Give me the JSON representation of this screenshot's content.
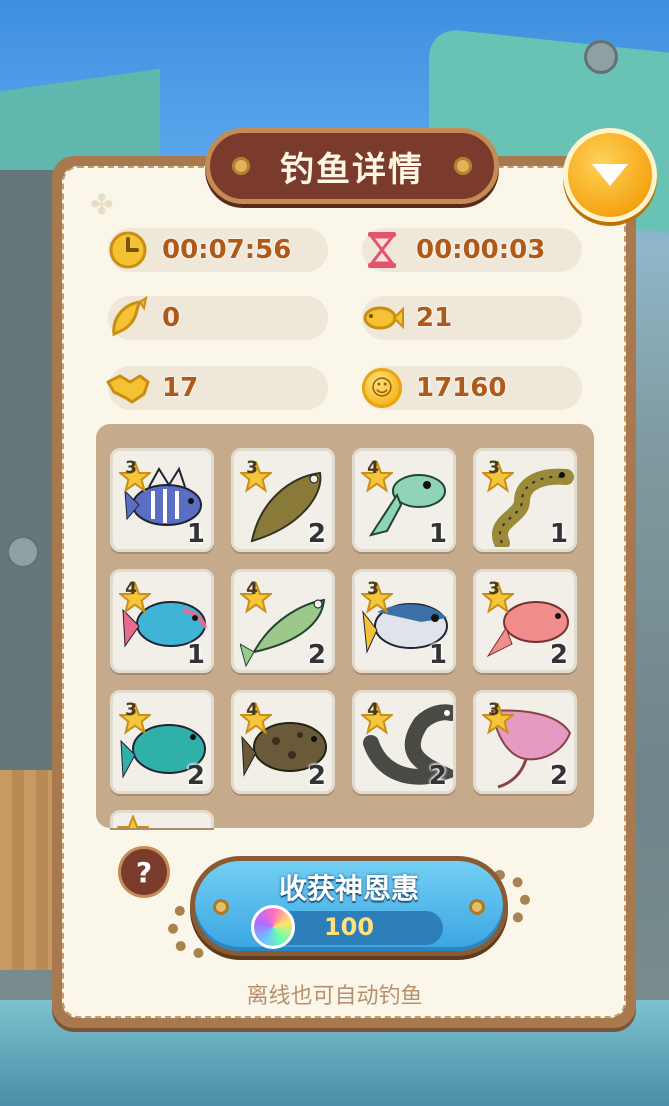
{
  "title": "钓鱼详情",
  "stats": {
    "elapsed_time": "00:07:56",
    "cooldown_time": "00:00:03",
    "big_catch_count": "0",
    "fish_count": "21",
    "handshake_count": "17",
    "coins": "17160"
  },
  "fish": [
    {
      "stars": "3",
      "count": "1",
      "name": "lionfish",
      "color": "#5a6fc4"
    },
    {
      "stars": "3",
      "count": "2",
      "name": "flounder",
      "color": "#8a7a3a"
    },
    {
      "stars": "4",
      "count": "1",
      "name": "pufferfish",
      "color": "#8fd4b6"
    },
    {
      "stars": "3",
      "count": "1",
      "name": "moray-eel",
      "color": "#9a8a3a"
    },
    {
      "stars": "4",
      "count": "1",
      "name": "parrotfish",
      "color": "#3fb4d6"
    },
    {
      "stars": "4",
      "count": "2",
      "name": "minnow",
      "color": "#9cc98a"
    },
    {
      "stars": "3",
      "count": "1",
      "name": "tuna",
      "color": "#3c6fa8"
    },
    {
      "stars": "3",
      "count": "2",
      "name": "red-snapper",
      "color": "#f08c8c"
    },
    {
      "stars": "3",
      "count": "2",
      "name": "wrasse",
      "color": "#2fb0a8"
    },
    {
      "stars": "4",
      "count": "2",
      "name": "grouper",
      "color": "#6b5a3a"
    },
    {
      "stars": "4",
      "count": "2",
      "name": "eel",
      "color": "#4a4a44"
    },
    {
      "stars": "3",
      "count": "2",
      "name": "stingray",
      "color": "#e59ac2"
    }
  ],
  "harvest_button": {
    "label": "收获神恩惠",
    "cost": "100"
  },
  "offline_hint": "离线也可自动钓鱼",
  "help_label": "?"
}
